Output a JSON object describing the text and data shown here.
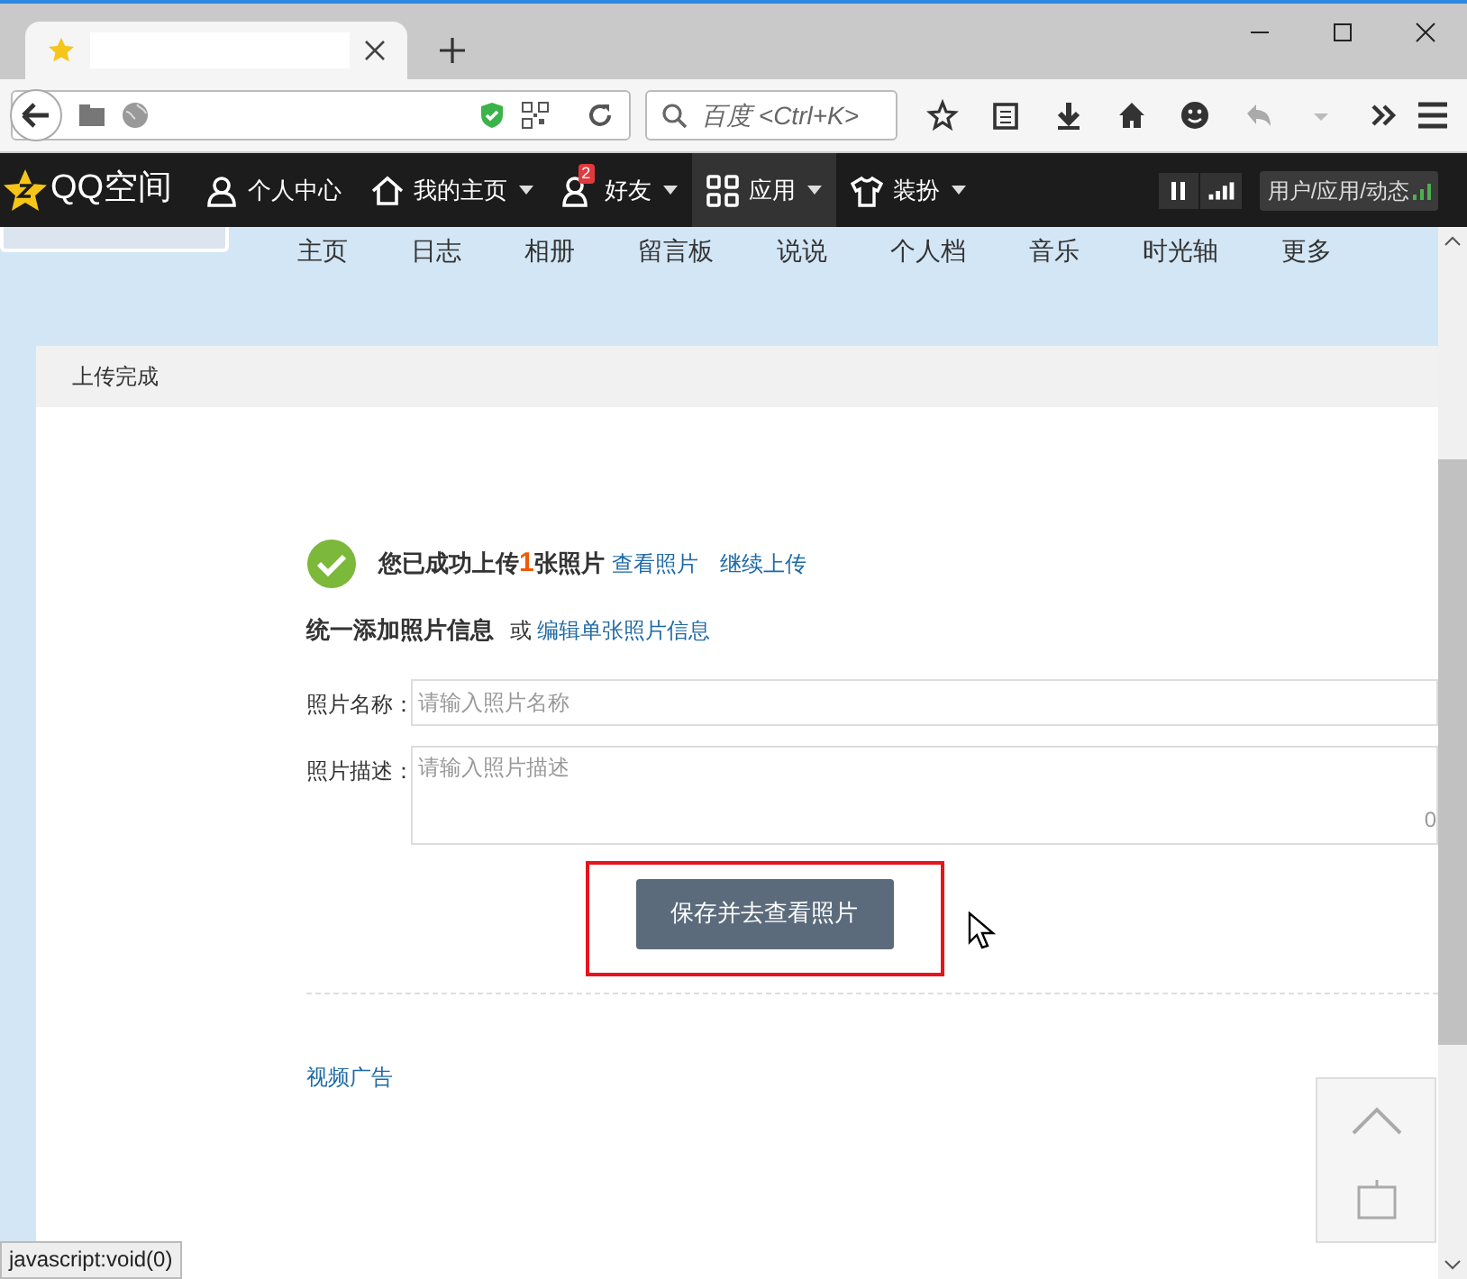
{
  "browser": {
    "search_placeholder": "百度 <Ctrl+K>",
    "status_text": "javascript:void(0)"
  },
  "topbar": {
    "logo": "QQ空间",
    "items": [
      {
        "label": "个人中心",
        "caret": false,
        "selected": false
      },
      {
        "label": "我的主页",
        "caret": true,
        "selected": false
      },
      {
        "label": "好友",
        "caret": true,
        "selected": false,
        "badge": "2"
      },
      {
        "label": "应用",
        "caret": true,
        "selected": true
      },
      {
        "label": "装扮",
        "caret": true,
        "selected": false
      }
    ],
    "right_label": "用户/应用/动态"
  },
  "subnav": [
    "主页",
    "日志",
    "相册",
    "留言板",
    "说说",
    "个人档",
    "音乐",
    "时光轴",
    "更多"
  ],
  "card": {
    "title": "上传完成",
    "success": {
      "prefix": "您已成功上传",
      "count": "1",
      "suffix": "张照片",
      "links": [
        "查看照片",
        "继续上传"
      ]
    },
    "section": {
      "heading": "统一添加照片信息",
      "or": "或",
      "link": "编辑单张照片信息"
    },
    "fields": [
      {
        "kind": "input",
        "label": "照片名称：",
        "placeholder": "请输入照片名称"
      },
      {
        "kind": "textarea",
        "label": "照片描述：",
        "placeholder": "请输入照片描述",
        "counter": "0"
      }
    ],
    "button": "保存并去查看照片",
    "highlighted": true,
    "ad_link": "视频广告"
  }
}
